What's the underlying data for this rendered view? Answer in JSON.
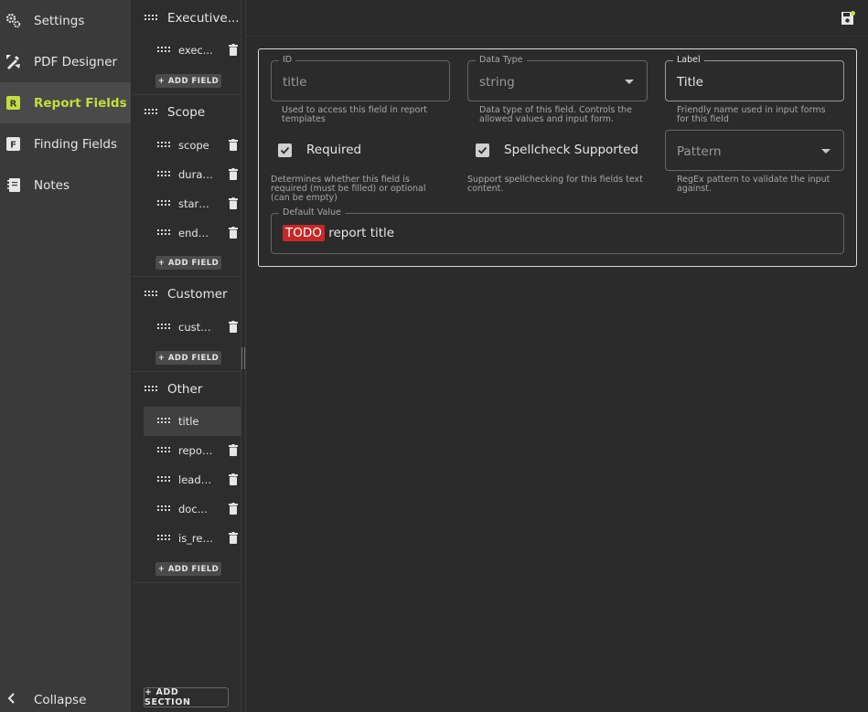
{
  "nav": {
    "items": [
      {
        "label": "Settings",
        "icon": "gears-icon"
      },
      {
        "label": "PDF Designer",
        "icon": "design-icon"
      },
      {
        "label": "Report Fields",
        "icon": "report-fields-icon",
        "active": true
      },
      {
        "label": "Finding Fields",
        "icon": "finding-fields-icon"
      },
      {
        "label": "Notes",
        "icon": "notes-icon"
      }
    ],
    "collapse_label": "Collapse"
  },
  "sections": [
    {
      "name": "Executive...",
      "fields": [
        "exec..."
      ],
      "add_label": "+ ADD FIELD"
    },
    {
      "name": "Scope",
      "fields": [
        "scope",
        "durat...",
        "start_...",
        "end_..."
      ],
      "add_label": "+ ADD FIELD"
    },
    {
      "name": "Customer",
      "fields": [
        "custo..."
      ],
      "add_label": "+ ADD FIELD"
    },
    {
      "name": "Other",
      "fields": [
        "title",
        "repor...",
        "lead_...",
        "docu...",
        "is_ret..."
      ],
      "add_label": "+ ADD FIELD",
      "active_field": "title"
    }
  ],
  "add_section_label": "+ ADD SECTION",
  "form": {
    "id": {
      "legend": "ID",
      "value": "title",
      "helper": "Used to access this field in report templates"
    },
    "data_type": {
      "legend": "Data Type",
      "value": "string",
      "helper": "Data type of this field. Controls the allowed values and input form."
    },
    "label": {
      "legend": "Label",
      "value": "Title",
      "helper": "Friendly name used in input forms for this field"
    },
    "required": {
      "label": "Required",
      "checked": true,
      "helper": "Determines whether this field is required (must be filled) or optional (can be empty)"
    },
    "spellcheck": {
      "label": "Spellcheck Supported",
      "checked": true,
      "helper": "Support spellchecking for this fields text content."
    },
    "pattern": {
      "placeholder": "Pattern",
      "helper": "RegEx pattern to validate the input against."
    },
    "default_value": {
      "legend": "Default Value",
      "todo": "TODO",
      "rest": " report title"
    }
  },
  "colors": {
    "accent": "#c6dd3c",
    "todo": "#c62828"
  }
}
